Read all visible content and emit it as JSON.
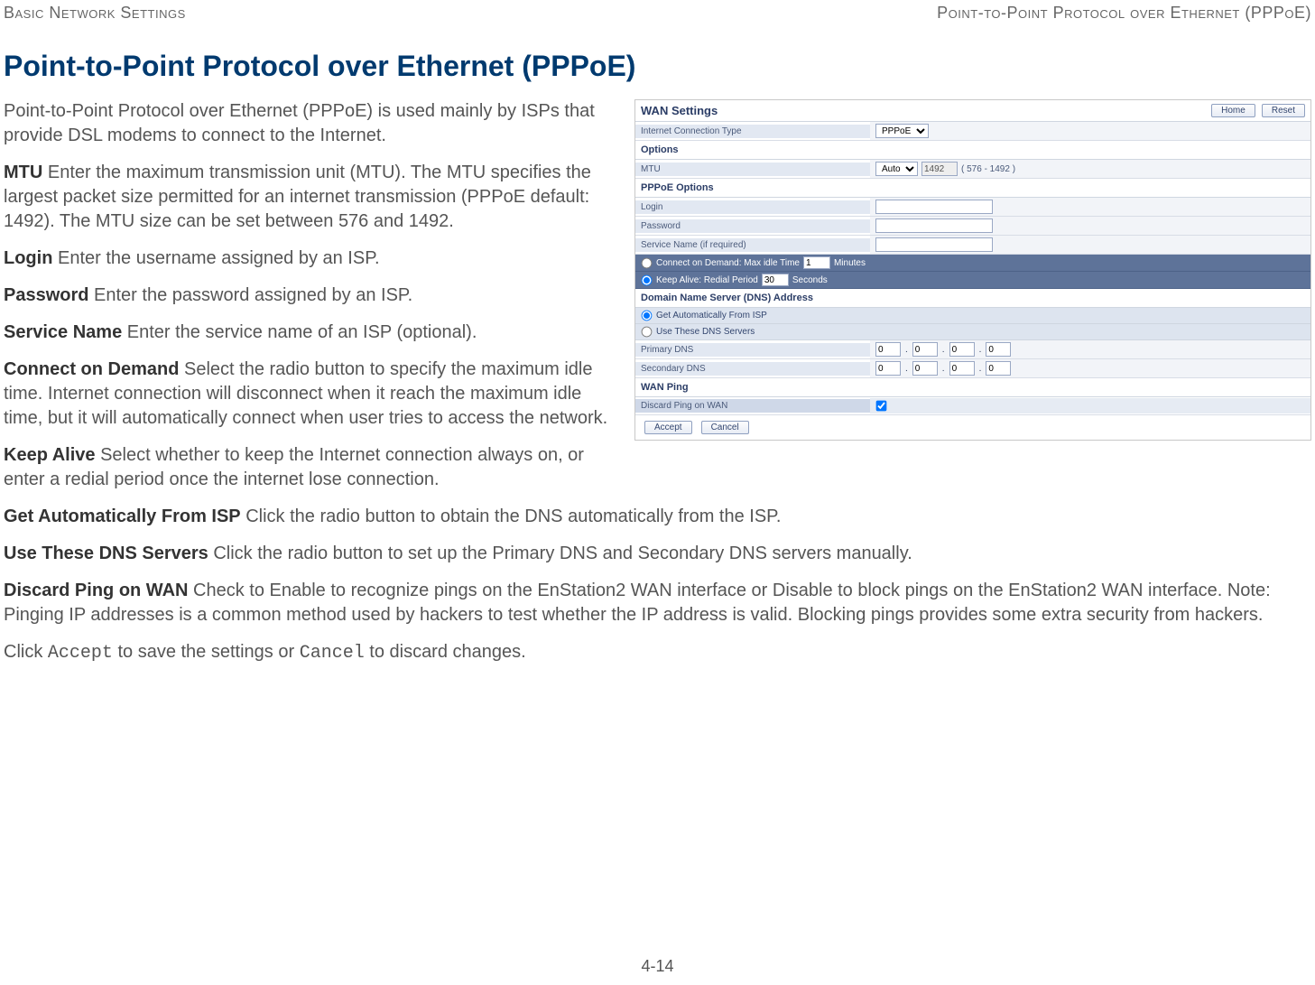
{
  "header": {
    "left": "Basic Network Settings",
    "right": "Point-to-Point Protocol over Ethernet (PPPoE)"
  },
  "title": "Point-to-Point Protocol over Ethernet (PPPoE)",
  "intro": "Point-to-Point Protocol over Ethernet (PPPoE) is used mainly by ISPs that provide DSL modems to connect to the Internet.",
  "items": {
    "mtu": {
      "term": "MTU",
      "text": "  Enter the maximum transmission unit (MTU). The MTU specifies the largest packet size permitted for an internet transmission (PPPoE default: 1492). The MTU size can be set between 576 and 1492."
    },
    "login": {
      "term": "Login",
      "text": "  Enter the username assigned by an ISP."
    },
    "password": {
      "term": "Password",
      "text": "  Enter the password assigned by an ISP."
    },
    "service": {
      "term": "Service Name",
      "text": "  Enter the service name of an ISP (optional)."
    },
    "cod": {
      "term": "Connect on Demand",
      "text": "  Select the radio button to specify the maximum idle time. Internet connection will disconnect when it reach the maximum idle time, but it will automatically connect when user tries to access the network."
    },
    "keepalive": {
      "term": "Keep Alive",
      "text": "  Select whether to keep the Internet connection always on, or enter a redial period once the internet lose connection."
    },
    "getauto": {
      "term": "Get Automatically From ISP",
      "text": "  Click the radio button to obtain the DNS automatically from the ISP."
    },
    "usedns": {
      "term": "Use These DNS Servers",
      "text": "  Click the radio button to set up the Primary DNS and Secondary DNS servers manually."
    },
    "discard": {
      "term": "Discard Ping on WAN",
      "text": "  Check to Enable to recognize pings on the EnStation2 WAN interface or Disable to block pings on the EnStation2 WAN interface. Note: Pinging IP addresses is a common method used by hackers to test whether the IP address is valid. Blocking pings provides some extra security from hackers."
    }
  },
  "closing": {
    "pre": "Click ",
    "accept": "Accept",
    "mid": " to save the settings or ",
    "cancel": "Cancel",
    "post": " to discard changes."
  },
  "pagenum": "4-14",
  "shot": {
    "title": "WAN Settings",
    "home": "Home",
    "reset": "Reset",
    "ict_label": "Internet Connection Type",
    "ict_value": "PPPoE",
    "options_heading": "Options",
    "mtu_label": "MTU",
    "mtu_mode": "Auto",
    "mtu_value": "1492",
    "mtu_range": "( 576 - 1492 )",
    "pppoe_heading": "PPPoE Options",
    "login_label": "Login",
    "password_label": "Password",
    "service_label": "Service Name (if required)",
    "cod_label": "Connect on Demand: Max idle Time",
    "cod_value": "1",
    "cod_unit": "Minutes",
    "ka_label": "Keep Alive: Redial Period",
    "ka_value": "30",
    "ka_unit": "Seconds",
    "dns_heading": "Domain Name Server (DNS) Address",
    "dns_auto": "Get Automatically From ISP",
    "dns_manual": "Use These DNS Servers",
    "pdns_label": "Primary DNS",
    "sdns_label": "Secondary DNS",
    "dns_octet": "0",
    "wanping_heading": "WAN Ping",
    "discard_label": "Discard Ping on WAN",
    "accept_btn": "Accept",
    "cancel_btn": "Cancel"
  }
}
